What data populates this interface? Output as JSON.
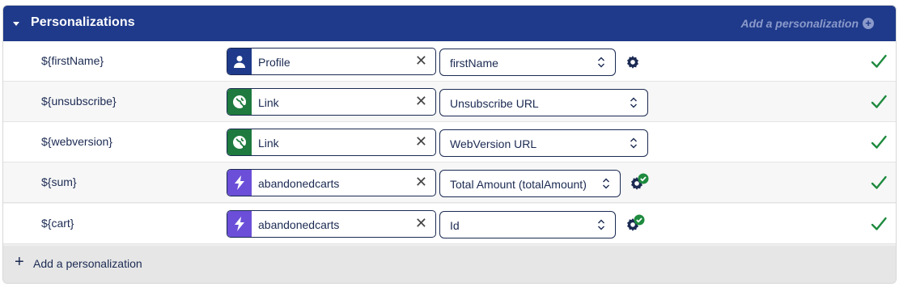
{
  "header": {
    "title": "Personalizations",
    "add_link": "Add a personalization",
    "bg_color": "#1f3a8a"
  },
  "rows": [
    {
      "variable": "${firstName}",
      "source": "Profile",
      "source_icon": "person-icon",
      "source_color": "#1f3a8a",
      "field": "firstName",
      "gear_checked": false,
      "valid": true
    },
    {
      "variable": "${unsubscribe}",
      "source": "Link",
      "source_icon": "globe-link-icon",
      "source_color": "#1e7a3e",
      "field": "Unsubscribe URL",
      "gear_checked": false,
      "valid": true
    },
    {
      "variable": "${webversion}",
      "source": "Link",
      "source_icon": "globe-link-icon",
      "source_color": "#1e7a3e",
      "field": "WebVersion URL",
      "gear_checked": false,
      "valid": true
    },
    {
      "variable": "${sum}",
      "source": "abandonedcarts",
      "source_icon": "lightning-icon",
      "source_color": "#6b4fd8",
      "field": "Total Amount (totalAmount)",
      "gear_checked": true,
      "valid": true
    },
    {
      "variable": "${cart}",
      "source": "abandonedcarts",
      "source_icon": "lightning-icon",
      "source_color": "#6b4fd8",
      "field": "Id",
      "gear_checked": true,
      "valid": true
    }
  ],
  "footer": {
    "add_label": "Add a personalization"
  },
  "colors": {
    "check_green": "#1e8a3e",
    "navy": "#1b2a52"
  }
}
